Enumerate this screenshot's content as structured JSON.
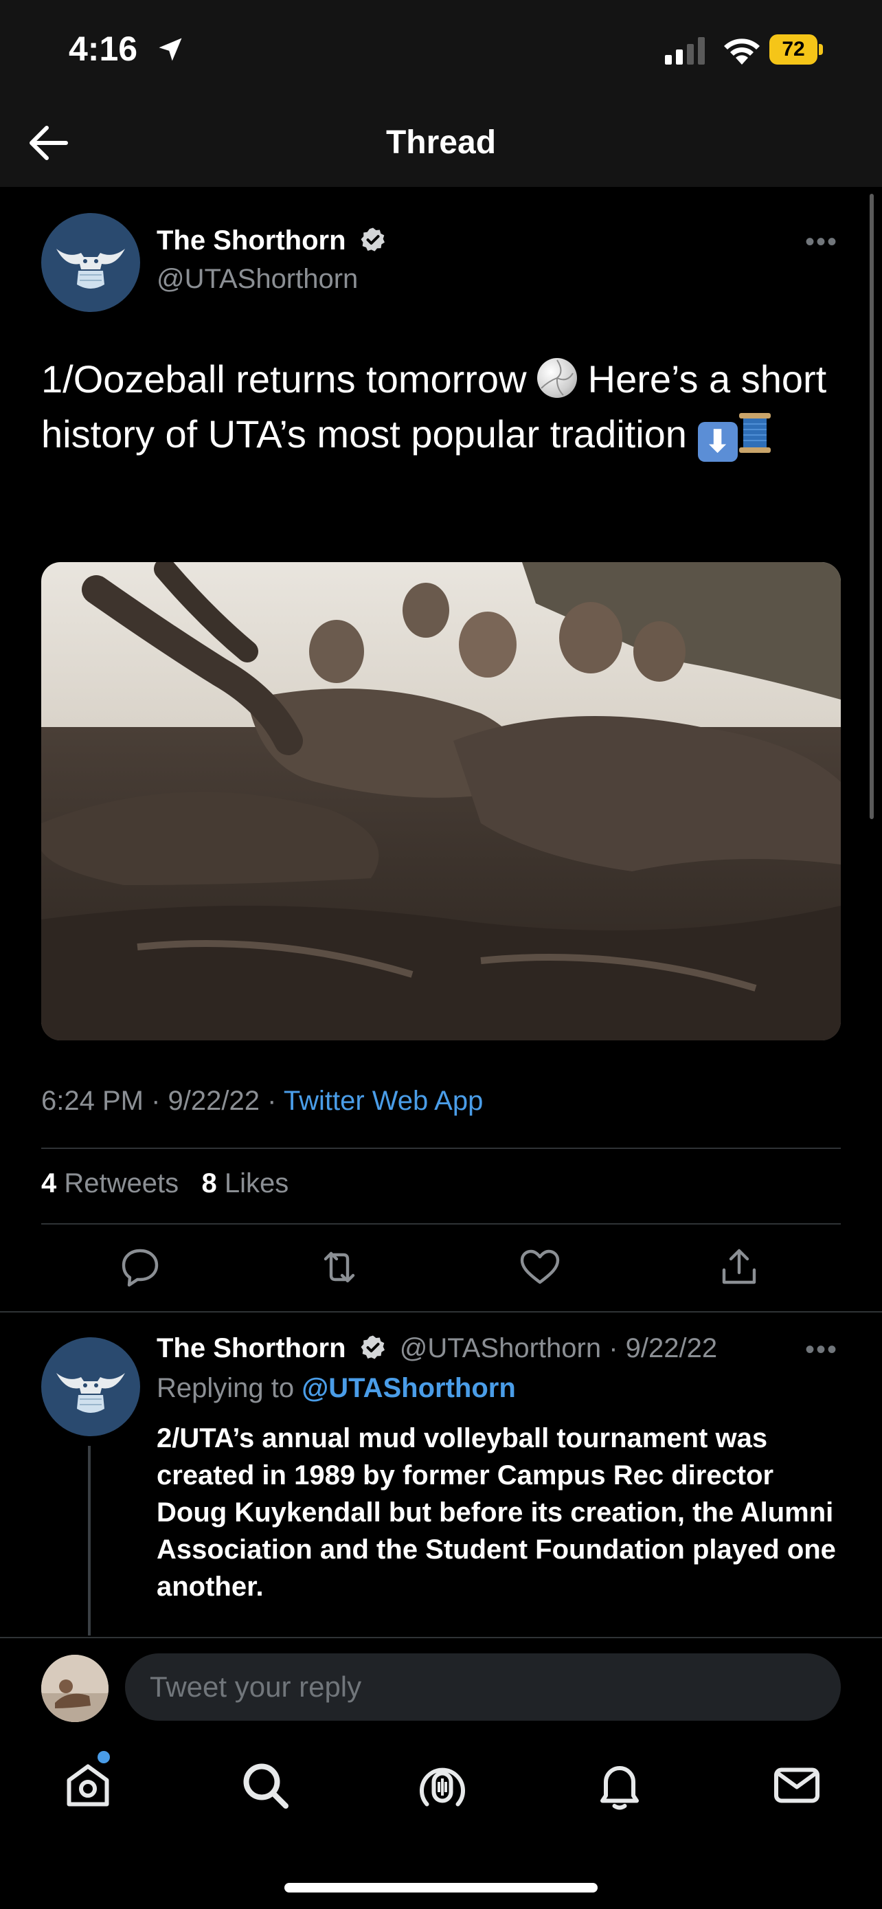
{
  "status": {
    "time": "4:16",
    "battery": "72"
  },
  "nav": {
    "title": "Thread"
  },
  "tweet": {
    "author_name": "The Shorthorn",
    "author_handle": "@UTAShorthorn",
    "text_part1": "1/Oozeball returns tomorrow ",
    "text_part2": " Here’s a short history of UTA’s most popular tradition ",
    "emoji_down": "⬇",
    "time": "6:24 PM",
    "date": "9/22/22",
    "source": "Twitter Web App",
    "retweets_count": "4",
    "retweets_label": "Retweets",
    "likes_count": "8",
    "likes_label": "Likes"
  },
  "reply": {
    "author_name": "The Shorthorn",
    "author_handle": "@UTAShorthorn",
    "date": "9/22/22",
    "replying_label": "Replying to",
    "replying_to": "@UTAShorthorn",
    "text": "2/UTA’s annual mud volleyball tournament was created in 1989 by former Campus Rec director Doug Kuykendall but before its creation, the Alumni Association and the Student Foundation played one another."
  },
  "compose": {
    "placeholder": "Tweet your reply"
  },
  "icons": {
    "back": "back-arrow-icon",
    "location": "location-arrow-icon",
    "verified": "verified-badge-icon",
    "reply": "reply-icon",
    "retweet": "retweet-icon",
    "like": "heart-icon",
    "share": "share-icon",
    "home": "home-icon",
    "search": "search-icon",
    "spaces": "spaces-icon",
    "notifications": "bell-icon",
    "messages": "mail-icon"
  },
  "colors": {
    "link": "#4a9de8",
    "background": "#000000",
    "battery": "#f5c518"
  }
}
